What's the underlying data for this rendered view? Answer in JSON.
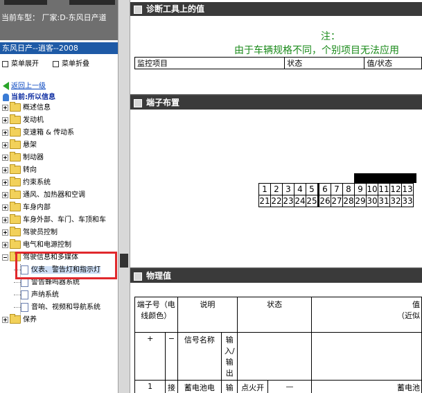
{
  "vehicle_bar": {
    "label": "当前车型：",
    "value": "厂家:D-东风日产道"
  },
  "left": {
    "title": "东风日产--逍客--2008",
    "expand_menu": "菜单展开",
    "collapse_menu": "菜单折叠",
    "back": "返回上一级",
    "current": "当前:所以信息",
    "tree": [
      "概述信息",
      "发动机",
      "变速箱 & 传动系",
      "悬架",
      "制动器",
      "转向",
      "约束系统",
      "通风、加热器和空调",
      "车身内部",
      "车身外部、车门、车顶和车",
      "驾驶员控制",
      "电气和电源控制",
      "驾驶信息和多媒体"
    ],
    "children": [
      "仪表、警告灯和指示灯",
      "警告蜂鸣器系统",
      "声纳系统",
      "音响、视频和导航系统"
    ],
    "last_item": "保养"
  },
  "right": {
    "section1_title": "诊断工具上的值",
    "note_title": "注：",
    "note_text": "由于车辆规格不同，个别项目无法应用",
    "monitor_headers": [
      "监控项目",
      "状态",
      "值/状态"
    ],
    "section2_title": "端子布置",
    "terminal_row1": [
      "1",
      "2",
      "3",
      "4",
      "5",
      "6",
      "7",
      "8",
      "9",
      "10",
      "11",
      "12",
      "13"
    ],
    "terminal_row2": [
      "21",
      "22",
      "23",
      "24",
      "25",
      "26",
      "27",
      "28",
      "29",
      "30",
      "31",
      "32",
      "33"
    ],
    "section3_title": "物理值",
    "phys_headers": {
      "terminal_no": "端子号（电线颜色）",
      "desc": "说明",
      "state": "状态",
      "value": "值",
      "value_sub": "（近似",
      "plus": "+",
      "minus": "−",
      "signal_name": "信号名称",
      "io": "输入/输出"
    },
    "phys_row1": {
      "terminal": "1",
      "minus": "接",
      "signal": "蓄电池电",
      "io": "输",
      "state": "点火开",
      "dash": "—",
      "value": "蓄电池"
    }
  }
}
